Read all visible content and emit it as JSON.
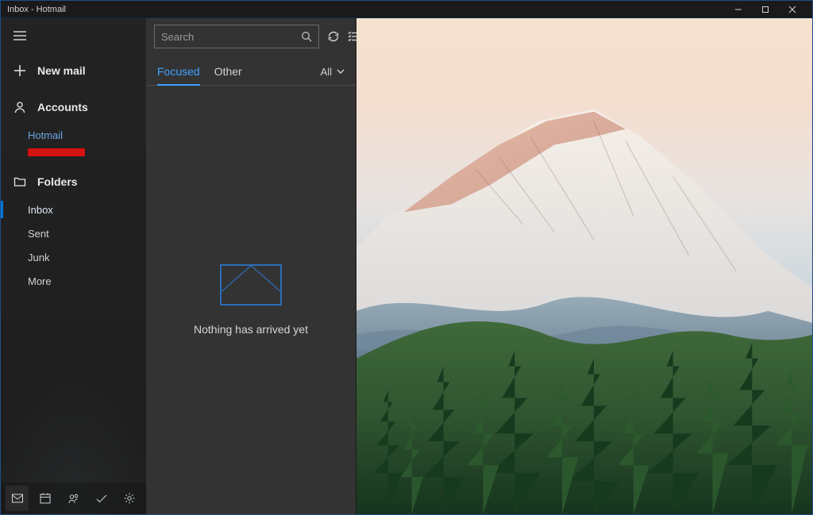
{
  "window": {
    "title": "Inbox - Hotmail"
  },
  "sidebar": {
    "new_mail_label": "New mail",
    "accounts_label": "Accounts",
    "account_name": "Hotmail",
    "folders_label": "Folders",
    "folders": {
      "inbox": "Inbox",
      "sent": "Sent",
      "junk": "Junk",
      "more": "More"
    }
  },
  "list": {
    "search_placeholder": "Search",
    "tabs": {
      "focused": "Focused",
      "other": "Other"
    },
    "filter_label": "All",
    "empty_message": "Nothing has arrived yet"
  },
  "colors": {
    "accent": "#3fa2ff",
    "link": "#6aa7e0",
    "border_blue": "#1f4e8c",
    "redaction": "#d11313"
  }
}
